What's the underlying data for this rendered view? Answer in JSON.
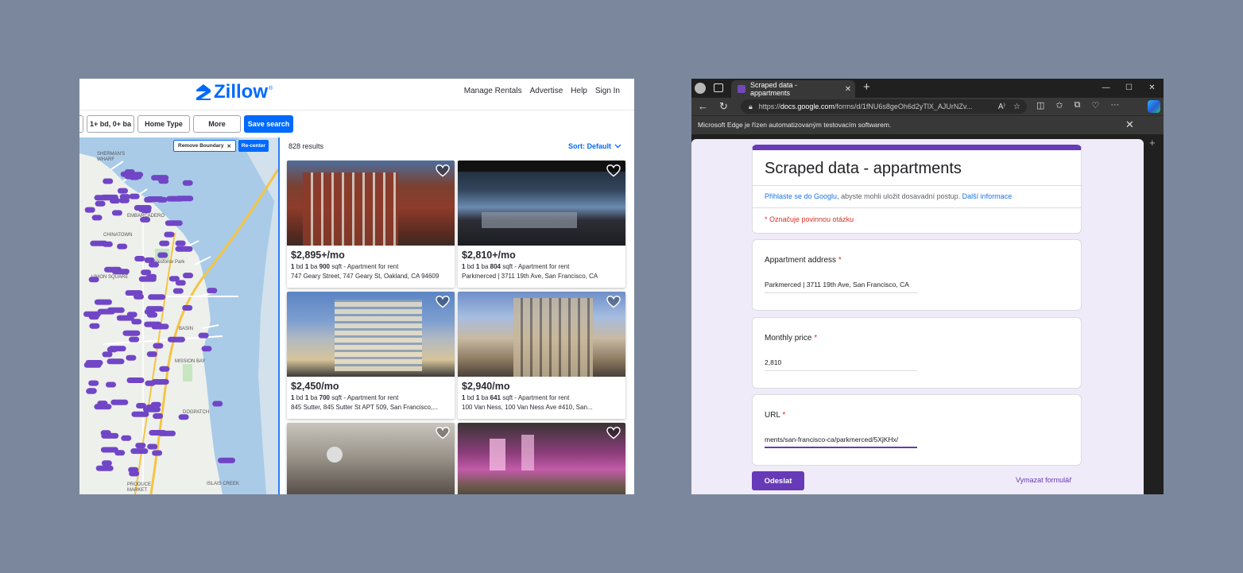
{
  "zillow": {
    "logo_text": "Zillow",
    "nav": [
      "Manage Rentals",
      "Advertise",
      "Help",
      "Sign In"
    ],
    "filters": {
      "beds_baths": "1+ bd, 0+ ba",
      "home_type": "Home Type",
      "more": "More",
      "save_search": "Save search"
    },
    "map": {
      "remove_boundary": "Remove Boundary",
      "recenter": "Re-center"
    },
    "results_count": "828 results",
    "sort": "Sort: Default",
    "listings": [
      {
        "price": "$2,895+/mo",
        "beds": "1",
        "baths": "1",
        "sqft": "900",
        "type": "Apartment for rent",
        "address": "747 Geary Street, 747 Geary St, Oakland, CA 94609"
      },
      {
        "price": "$2,810+/mo",
        "beds": "1",
        "baths": "1",
        "sqft": "804",
        "type": "Apartment for rent",
        "address": "Parkmerced | 3711 19th Ave, San Francisco, CA"
      },
      {
        "price": "$2,450/mo",
        "beds": "1",
        "baths": "1",
        "sqft": "700",
        "type": "Apartment for rent",
        "address": "845 Sutter, 845 Sutter St APT 509, San Francisco,..."
      },
      {
        "price": "$2,940/mo",
        "beds": "1",
        "baths": "1",
        "sqft": "641",
        "type": "Apartment for rent",
        "address": "100 Van Ness, 100 Van Ness Ave #410, San..."
      }
    ],
    "labels": {
      "bd": "bd",
      "ba": "ba",
      "sqft": "sqft"
    },
    "colors": {
      "brand": "#006aff",
      "marker": "#7146c6"
    }
  },
  "edge": {
    "tab_title": "Scraped data - appartments",
    "url_prefix": "https://",
    "url_host": "docs.google.com",
    "url_path": "/forms/d/1fNU6s8geOh6d2yTlX_AJUrNZv...",
    "infobar_text": "Microsoft Edge je řízen automatizovaným testovacím softwarem.",
    "accent": "#673ab7"
  },
  "form": {
    "title": "Scraped data - appartments",
    "signin_link": "Přihlaste se do Googlu",
    "signin_text": ", abyste mohli uložit dosavadní postup.",
    "more_info": "Další informace",
    "required_note": "* Označuje povinnou otázku",
    "questions": [
      {
        "label": "Appartment address",
        "value": "Parkmerced | 3711 19th Ave, San Francisco, CA"
      },
      {
        "label": "Monthly price",
        "value": "2,810"
      },
      {
        "label": "URL",
        "value": "ments/san-francisco-ca/parkmerced/5XjKHx/"
      }
    ],
    "submit": "Odeslat",
    "clear": "Vymazat formulář"
  }
}
